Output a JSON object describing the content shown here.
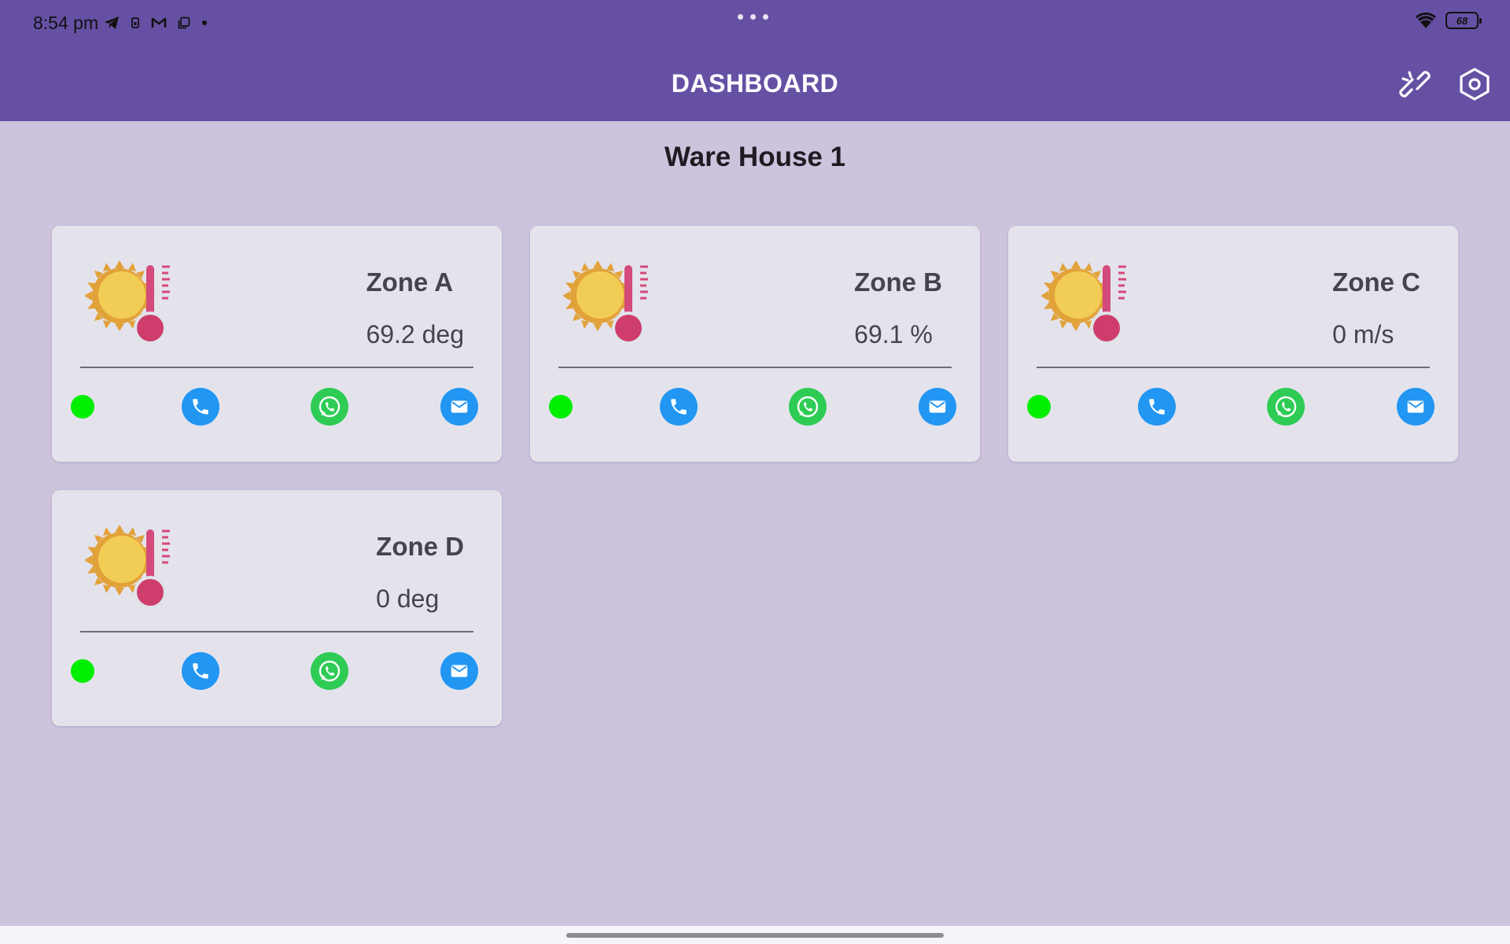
{
  "status_bar": {
    "time": "8:54 pm",
    "battery": "68"
  },
  "app_bar": {
    "title": "DASHBOARD",
    "icons": [
      "unlink-icon",
      "settings-icon"
    ]
  },
  "page": {
    "title": "Ware House 1"
  },
  "zones": [
    {
      "name": "Zone A",
      "value": "69.2 deg",
      "status": "online"
    },
    {
      "name": "Zone B",
      "value": "69.1 %",
      "status": "online"
    },
    {
      "name": "Zone C",
      "value": "0 m/s",
      "status": "online"
    },
    {
      "name": "Zone D",
      "value": "0 deg",
      "status": "online"
    }
  ],
  "colors": {
    "app_bar": "#6650a4",
    "background": "#cdc3dd",
    "card": "#e4e3ec",
    "status_online": "#00ee00",
    "call": "#2196f3",
    "whatsapp": "#2ecc55",
    "mail": "#2196f3"
  }
}
